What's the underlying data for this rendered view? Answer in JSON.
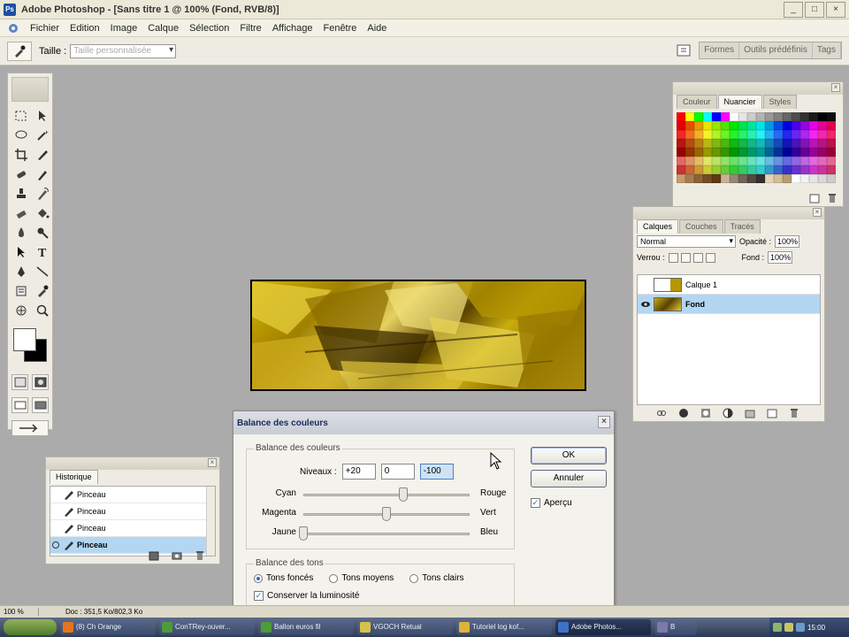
{
  "window": {
    "title": "Adobe Photoshop - [Sans titre 1 @ 100% (Fond, RVB/8)]",
    "controls": [
      "_",
      "□",
      "×"
    ]
  },
  "menu": [
    "Fichier",
    "Edition",
    "Image",
    "Calque",
    "Sélection",
    "Filtre",
    "Affichage",
    "Fenêtre",
    "Aide"
  ],
  "options_bar": {
    "size_label": "Taille :",
    "size_value": "Taille personnalisée",
    "palette_tabs": [
      "Formes",
      "Outils prédéfinis",
      "Tags"
    ]
  },
  "swatches_panel": {
    "tabs": [
      "Couleur",
      "Nuancier",
      "Styles"
    ],
    "active_tab": "Nuancier"
  },
  "layers_panel": {
    "tabs": [
      "Calques",
      "Couches",
      "Tracés"
    ],
    "blend_mode": "Normal",
    "opacity_label": "Opacité :",
    "opacity_value": "100%",
    "lock_label": "Verrou :",
    "fill_label": "Fond :",
    "fill_value": "100%",
    "layers": [
      {
        "name": "Calque 1",
        "selected": false,
        "visible": false
      },
      {
        "name": "Fond",
        "selected": true,
        "visible": true
      }
    ]
  },
  "history_panel": {
    "tab": "Historique",
    "items": [
      "Pinceau",
      "Pinceau",
      "Pinceau",
      "Pinceau"
    ],
    "selected_index": 3
  },
  "dialog": {
    "title": "Balance des couleurs",
    "group1_label": "Balance des couleurs",
    "levels_label": "Niveaux :",
    "levels": [
      "+20",
      "0",
      "-100"
    ],
    "sliders": [
      {
        "left": "Cyan",
        "right": "Rouge",
        "value": 20
      },
      {
        "left": "Magenta",
        "right": "Vert",
        "value": 0
      },
      {
        "left": "Jaune",
        "right": "Bleu",
        "value": -100
      }
    ],
    "group2_label": "Balance des tons",
    "tones": [
      "Tons foncés",
      "Tons moyens",
      "Tons clairs"
    ],
    "selected_tone": 0,
    "preserve_label": "Conserver la luminosité",
    "preserve_checked": true,
    "ok_label": "OK",
    "cancel_label": "Annuler",
    "preview_label": "Aperçu",
    "preview_checked": true
  },
  "status_bar": {
    "zoom": "100 %",
    "doc": "Doc : 351,5 Ko/802,3 Ko"
  },
  "taskbar": {
    "items": [
      "(8) Ch Orange",
      "ConTRey-ouver...",
      "Ballon euros fil",
      "VGOCH Retual",
      "Tutoriel log kof...",
      "Adobe Photos...",
      "B"
    ],
    "active_index": 5,
    "clock": "15:00"
  },
  "colors": {
    "accent": "#b3d6f2",
    "canvas_yellow": "#c9ad10",
    "workspace": "#ababab"
  }
}
